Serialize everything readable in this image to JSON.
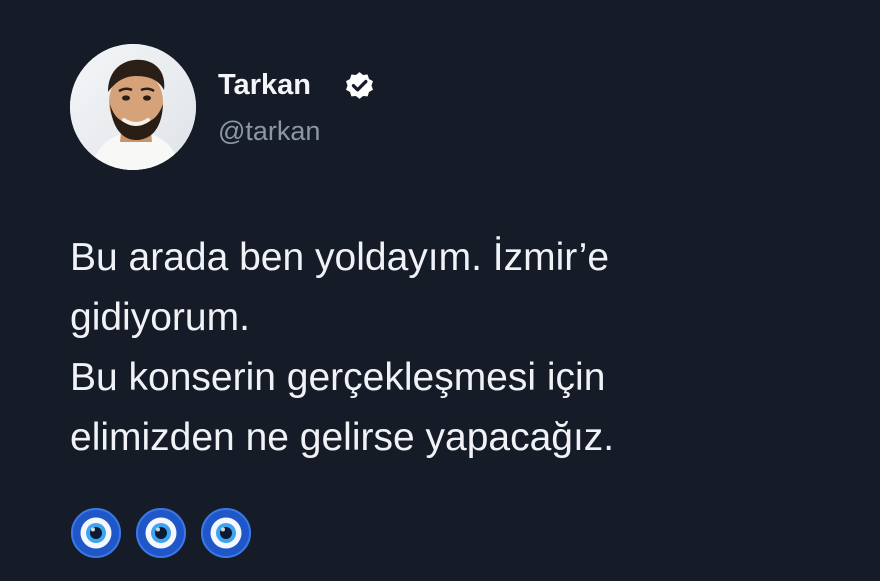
{
  "tweet": {
    "author": {
      "display_name": "Tarkan",
      "handle": "@tarkan",
      "verified": true,
      "avatar_icon": "profile-photo"
    },
    "lines": [
      "Bu arada ben yoldayım. İzmir’e",
      "gidiyorum.",
      "Bu konserin gerçekleşmesi için",
      "elimizden ne gelirse yapacağız."
    ],
    "emojis": [
      "🧿",
      "🧿",
      "🧿"
    ],
    "colors": {
      "background": "#161b28",
      "text": "#f0f2f6",
      "handle": "#8b97a6"
    }
  }
}
